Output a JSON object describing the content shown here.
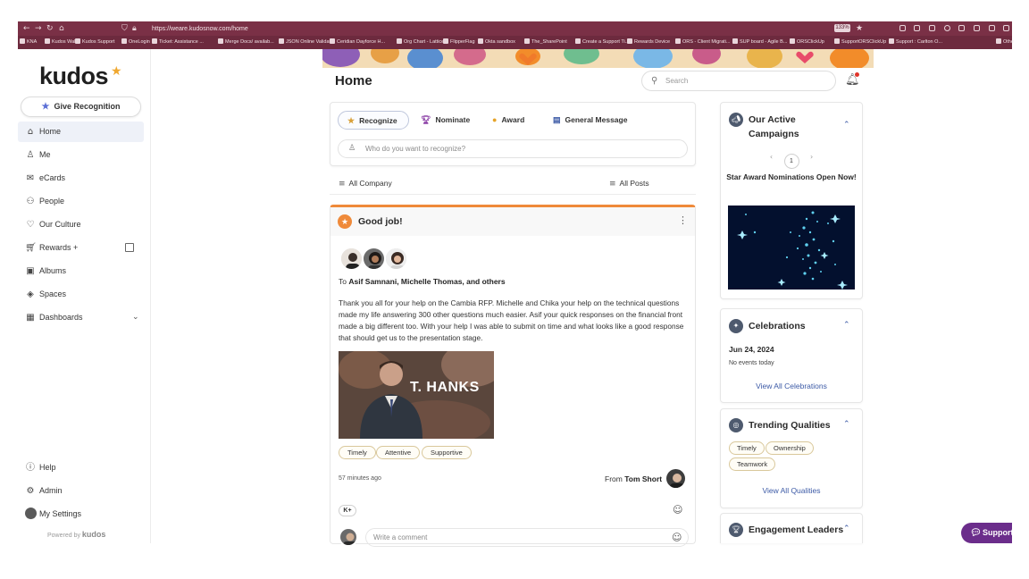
{
  "browser": {
    "url": "https://weare.kudosnow.com/home",
    "zoom": "133%",
    "bookmarks": [
      "KNA",
      "Kudos Wall",
      "Kudos Support",
      "OneLogin",
      "Ticket: Assistance ...",
      "Merge Docs/ availab...",
      "JSON Online Validat...",
      "Ceridian Dayforce H...",
      "Org Chart - Lattice",
      "FlipperFlag",
      "Okta sandbox",
      "The_SharePoint",
      "Create a Support Ti...",
      "Rewards Device",
      "ORS - Client Migrati...",
      "SUP board - Agile B...",
      "ORSClickUp",
      "SupportORSClickUp",
      "Support : Carlton O...",
      "Othe"
    ]
  },
  "brand": {
    "logo": "kudos",
    "accent": "#ef8a3a",
    "link": "#3c5aa6"
  },
  "sidebar": {
    "give_recognition": "Give Recognition",
    "items": [
      {
        "label": "Home",
        "icon": "home-icon"
      },
      {
        "label": "Me",
        "icon": "user-icon"
      },
      {
        "label": "eCards",
        "icon": "mail-icon"
      },
      {
        "label": "People",
        "icon": "people-icon"
      },
      {
        "label": "Our Culture",
        "icon": "heart-icon"
      },
      {
        "label": "Rewards +",
        "icon": "cart-icon"
      },
      {
        "label": "Albums",
        "icon": "album-icon"
      },
      {
        "label": "Spaces",
        "icon": "layers-icon"
      },
      {
        "label": "Dashboards",
        "icon": "dashboard-icon"
      }
    ],
    "bottom_items": [
      {
        "label": "Help",
        "icon": "help-icon"
      },
      {
        "label": "Admin",
        "icon": "gear-icon"
      },
      {
        "label": "My Settings",
        "icon": "avatar"
      }
    ],
    "powered_by": "Powered by",
    "powered_brand": "kudos"
  },
  "header": {
    "title": "Home",
    "search_placeholder": "Search"
  },
  "composer": {
    "tabs": [
      {
        "label": "Recognize",
        "icon": "star-icon"
      },
      {
        "label": "Nominate",
        "icon": "trophy-icon"
      },
      {
        "label": "Award",
        "icon": "medal-icon"
      },
      {
        "label": "General Message",
        "icon": "message-icon"
      }
    ],
    "placeholder": "Who do you want to recognize?"
  },
  "filters": {
    "left": "All Company",
    "right": "All Posts"
  },
  "post": {
    "title": "Good job!",
    "recipients_prefix": "To",
    "recipients": "Asif Samnani, Michelle Thomas, and others",
    "body": "Thank you all for your help on the Cambia RFP. Michelle and Chika your help on the technical questions made my life answering 300 other questions much easier. Asif your quick responses on the financial front made a big different too. With your help I was able to submit on time and what looks like a good response that should get us to the presentation stage.",
    "gif_caption": "T. HANKS",
    "tags": [
      "Timely",
      "Attentive",
      "Supportive"
    ],
    "time": "57 minutes ago",
    "from_prefix": "From",
    "from_name": "Tom Short",
    "kplus": "K+",
    "comment_placeholder": "Write a comment"
  },
  "panels": {
    "campaigns": {
      "title": "Our Active Campaigns",
      "page": "1",
      "campaign_name": "Star Award Nominations Open Now!"
    },
    "celebrations": {
      "title": "Celebrations",
      "date": "Jun 24, 2024",
      "empty": "No events today",
      "link": "View All Celebrations"
    },
    "qualities": {
      "title": "Trending Qualities",
      "tags": [
        "Timely",
        "Ownership",
        "Teamwork"
      ],
      "link": "View All Qualities"
    },
    "leaders": {
      "title": "Engagement Leaders"
    }
  },
  "support_button": "Support"
}
